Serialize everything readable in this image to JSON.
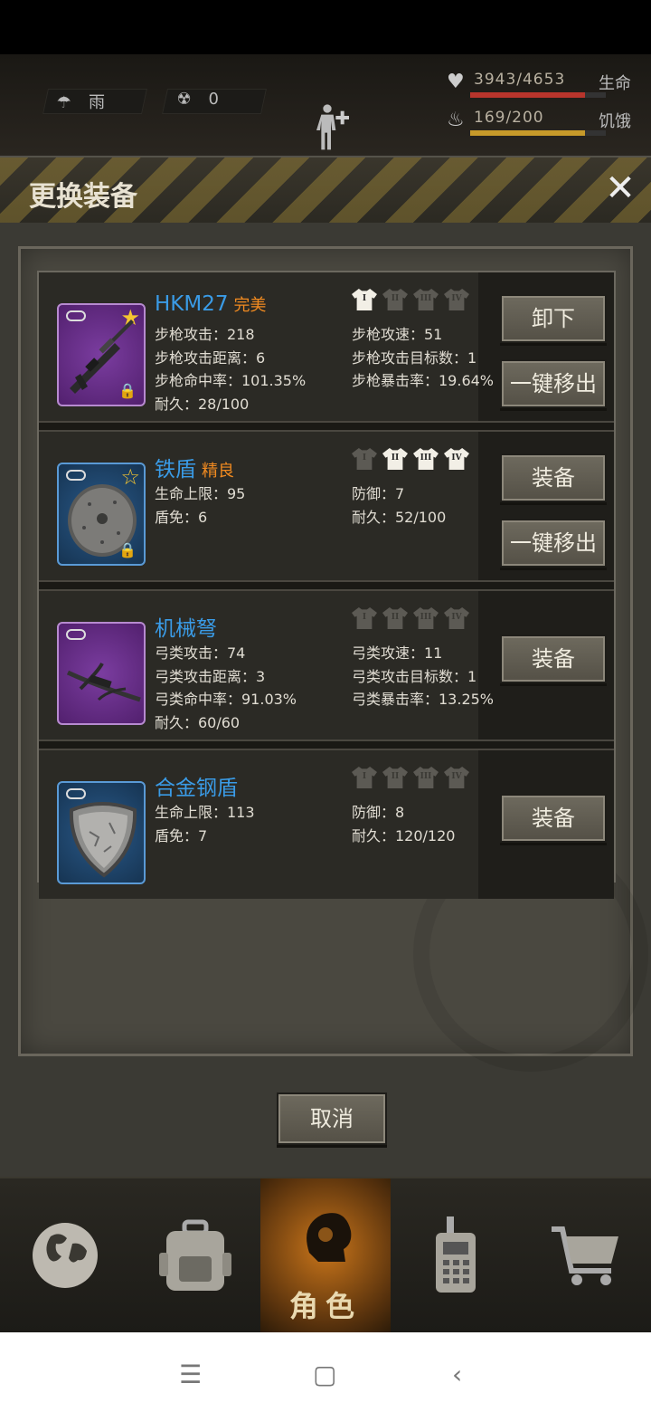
{
  "hud": {
    "weather": "雨",
    "radiation": "0",
    "hp": {
      "value": "3943/4653",
      "label": "生命",
      "fraction": 0.847,
      "color": "#b8352c"
    },
    "hunger": {
      "value": "169/200",
      "label": "饥饿",
      "fraction": 0.845,
      "color": "#c79a2a"
    }
  },
  "modal": {
    "title": "更换装备",
    "cancel_label": "取消"
  },
  "items": [
    {
      "name": "HKM27",
      "quality": "完美",
      "rarity": "purple",
      "star": "filled",
      "locked": true,
      "icon": "rifle-icon",
      "tiers": [
        true,
        false,
        false,
        false
      ],
      "stats_left": [
        "步枪攻击：218",
        "步枪攻击距离：6",
        "步枪命中率：101.35%",
        "耐久：28/100"
      ],
      "stats_right": [
        "步枪攻速：51",
        "步枪攻击目标数：1",
        "步枪暴击率：19.64%"
      ],
      "buttons": [
        "卸下",
        "一键移出"
      ]
    },
    {
      "name": "铁盾",
      "quality": "精良",
      "rarity": "blue",
      "star": "outline",
      "locked": true,
      "icon": "round-shield-icon",
      "tiers": [
        false,
        true,
        true,
        true
      ],
      "stats_left": [
        "生命上限：95",
        "盾免：6"
      ],
      "stats_right": [
        "防御：7",
        "耐久：52/100"
      ],
      "buttons": [
        "装备",
        "一键移出"
      ]
    },
    {
      "name": "机械弩",
      "quality": "",
      "rarity": "purple",
      "star": "",
      "locked": false,
      "icon": "crossbow-icon",
      "tiers": [
        false,
        false,
        false,
        false
      ],
      "stats_left": [
        "弓类攻击：74",
        "弓类攻击距离：3",
        "弓类命中率：91.03%",
        "耐久：60/60"
      ],
      "stats_right": [
        "弓类攻速：11",
        "弓类攻击目标数：1",
        "弓类暴击率：13.25%"
      ],
      "buttons": [
        "装备"
      ]
    },
    {
      "name": "合金钢盾",
      "quality": "",
      "rarity": "blue",
      "star": "",
      "locked": false,
      "icon": "steel-shield-icon",
      "tiers": [
        false,
        false,
        false,
        false
      ],
      "stats_left": [
        "生命上限：113",
        "盾免：7"
      ],
      "stats_right": [
        "防御：8",
        "耐久：120/120"
      ],
      "buttons": [
        "装备"
      ]
    }
  ],
  "tier_numerals": [
    "I",
    "II",
    "III",
    "IV"
  ],
  "nav": {
    "items": [
      "globe-icon",
      "backpack-icon",
      "character-icon",
      "radio-icon",
      "cart-icon"
    ],
    "active_label": "角色"
  }
}
